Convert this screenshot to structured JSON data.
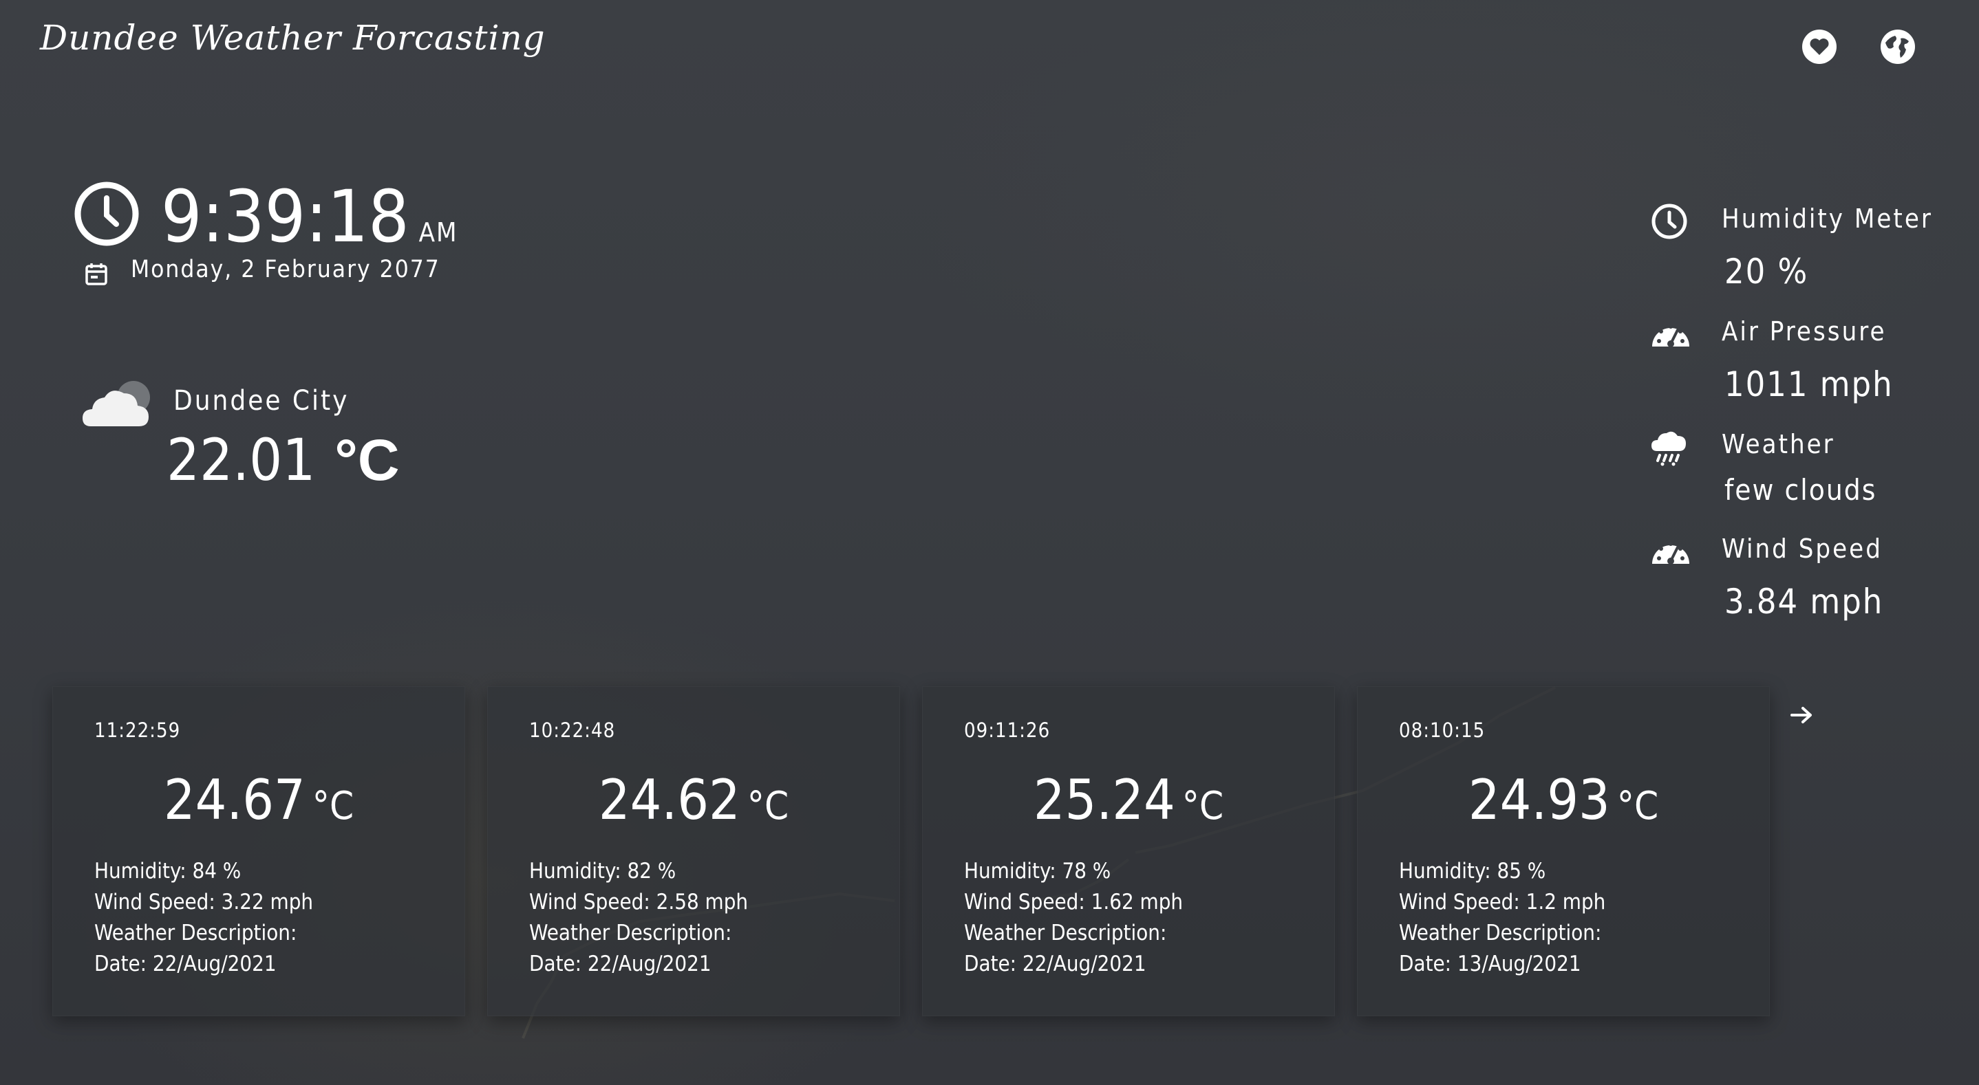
{
  "app": {
    "title": "Dundee Weather Forcasting"
  },
  "header_icons": {
    "favorite": "heart-icon",
    "language": "globe-icon"
  },
  "clock": {
    "time": "9:39:18",
    "ampm": "AM",
    "date": "Monday, 2 February 2077"
  },
  "location": {
    "city": "Dundee City",
    "temperature": "22.01",
    "unit": "°C",
    "icon": "cloud-icon"
  },
  "stats": [
    {
      "label": "Humidity Meter",
      "value": "20 %",
      "icon": "clock-icon"
    },
    {
      "label": "Air Pressure",
      "value": "1011 mph",
      "icon": "gauge-icon"
    },
    {
      "label": "Weather",
      "value": "few clouds",
      "icon": "rain-cloud-icon"
    },
    {
      "label": "Wind Speed",
      "value": "3.84 mph",
      "icon": "gauge-icon"
    }
  ],
  "forecast": [
    {
      "time": "11:22:59",
      "temp": "24.67",
      "unit": "°C",
      "humidity": "Humidity: 84 %",
      "wind": "Wind Speed: 3.22 mph",
      "desc": "Weather Description:",
      "date": "Date: 22/Aug/2021"
    },
    {
      "time": "10:22:48",
      "temp": "24.62",
      "unit": "°C",
      "humidity": "Humidity: 82 %",
      "wind": "Wind Speed: 2.58 mph",
      "desc": "Weather Description:",
      "date": "Date: 22/Aug/2021"
    },
    {
      "time": "09:11:26",
      "temp": "25.24",
      "unit": "°C",
      "humidity": "Humidity: 78 %",
      "wind": "Wind Speed: 1.62 mph",
      "desc": "Weather Description:",
      "date": "Date: 22/Aug/2021"
    },
    {
      "time": "08:10:15",
      "temp": "24.93",
      "unit": "°C",
      "humidity": "Humidity: 85 %",
      "wind": "Wind Speed: 1.2 mph",
      "desc": "Weather Description:",
      "date": "Date: 13/Aug/2021"
    }
  ],
  "nav": {
    "next_icon": "arrow-right-icon"
  },
  "colors": {
    "background": "#3b3e43",
    "card": "#313338",
    "text": "#ffffff"
  }
}
